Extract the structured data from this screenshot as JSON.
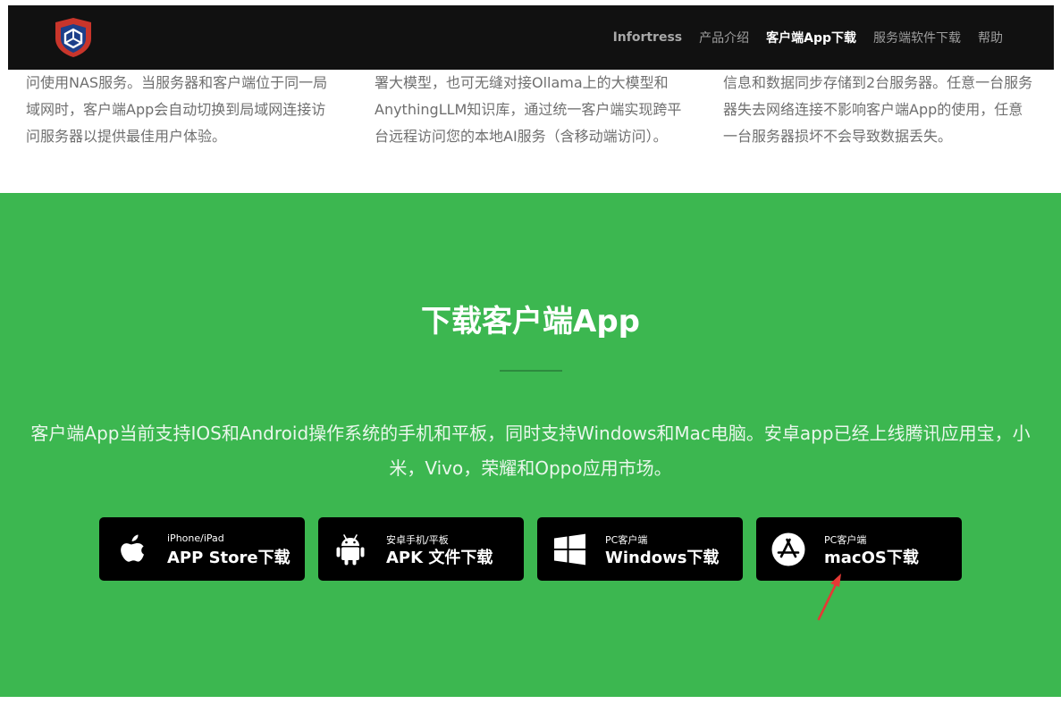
{
  "navbar": {
    "logo": "shield-logo",
    "links": [
      "Infortress",
      "产品介绍",
      "客户端App下载",
      "服务端软件下载",
      "帮助"
    ],
    "active_link": "客户端App下载"
  },
  "features": [
    {
      "lines": [
        "问使用NAS服务。当服务器和客户端位于同一局",
        "域网时，客户端App会自动切换到局域网连接访",
        "问服务器以提供最佳用户体验。"
      ]
    },
    {
      "lines": [
        "署大模型，也可无缝对接Ollama上的大模型和",
        "AnythingLLM知识库，通过统一客户端实现跨平",
        "台远程访问您的本地AI服务（含移动端访问）。"
      ]
    },
    {
      "lines": [
        "信息和数据同步存储到2台服务器。任意一台服务",
        "器失去网络连接不影响客户端App的使用，任意",
        "一台服务器损坏不会导致数据丢失。"
      ]
    }
  ],
  "download": {
    "title": "下载客户端App",
    "description": "客户端App当前支持IOS和Android操作系统的手机和平板，同时支持Windows和Mac电脑。安卓app已经上线腾讯应用宝，小米，Vivo，荣耀和Oppo应用市场。",
    "buttons": [
      {
        "icon": "apple-icon",
        "sub": "iPhone/iPad",
        "label": "APP Store下载"
      },
      {
        "icon": "android-icon",
        "sub": "安卓手机/平板",
        "label": "APK 文件下载"
      },
      {
        "icon": "windows-icon",
        "sub": "PC客户端",
        "label": "Windows下载"
      },
      {
        "icon": "app-store-icon",
        "sub": "PC客户端",
        "label": "macOS下载"
      }
    ]
  },
  "colors": {
    "navbar_bg": "#111111",
    "section_green": "#3cb750",
    "button_bg": "#000000",
    "annotation_arrow": "#e53935"
  }
}
